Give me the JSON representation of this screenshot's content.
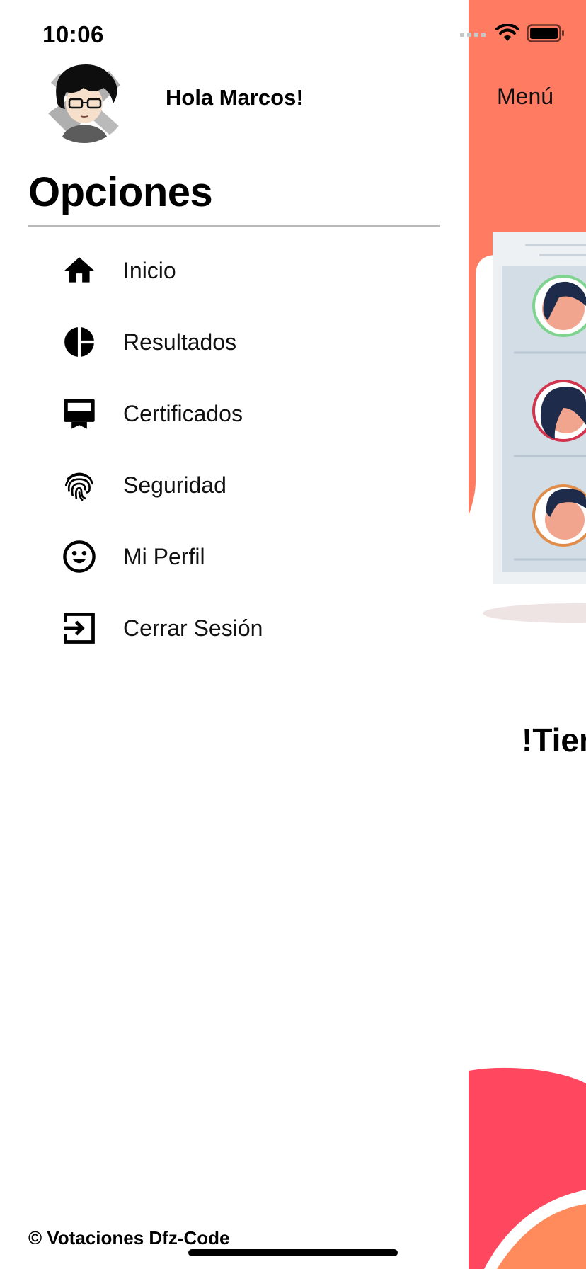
{
  "status_bar": {
    "time": "10:06"
  },
  "main_screen": {
    "menu_label": "Menú",
    "heading_partial": "!Tien",
    "colors": {
      "top_shape": "#FF7B62",
      "bottom_shape": "#FF4760",
      "bottom_accent": "#FF8A5C"
    }
  },
  "drawer": {
    "greeting": "Hola Marcos!",
    "section_title": "Opciones",
    "items": [
      {
        "label": "Inicio",
        "icon": "home-icon"
      },
      {
        "label": "Resultados",
        "icon": "pie-chart-icon"
      },
      {
        "label": "Certificados",
        "icon": "certificate-icon"
      },
      {
        "label": "Seguridad",
        "icon": "fingerprint-icon"
      },
      {
        "label": "Mi Perfil",
        "icon": "smiley-face-icon"
      },
      {
        "label": "Cerrar Sesión",
        "icon": "logout-icon"
      }
    ],
    "footer": "© Votaciones Dfz-Code"
  }
}
